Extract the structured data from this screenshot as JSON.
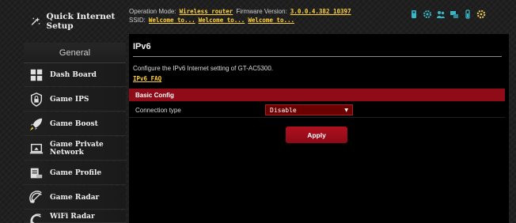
{
  "sidebar": {
    "quick_setup_label": "Quick Internet Setup",
    "quick_setup_icon": "wizard-icon",
    "section_header": "General",
    "items": [
      {
        "label": "Dash Board",
        "icon": "dashboard-icon"
      },
      {
        "label": "Game IPS",
        "icon": "shield-lock-icon"
      },
      {
        "label": "Game Boost",
        "icon": "rocket-icon"
      },
      {
        "label": "Game Private Network",
        "icon": "laptop-icon"
      },
      {
        "label": "Game Profile",
        "icon": "profile-icon"
      },
      {
        "label": "Game Radar",
        "icon": "radar-icon"
      },
      {
        "label": "WiFi Radar",
        "icon": "wifi-radar-icon"
      }
    ]
  },
  "topbar": {
    "operation_mode_label": "Operation Mode:",
    "operation_mode_value": "Wireless router",
    "firmware_label": "Firmware Version:",
    "firmware_value": "3.0.0.4.382_10397",
    "ssid_label": "SSID:",
    "ssid_values": [
      "Welcome to...",
      "Welcome to...",
      "Welcome to..."
    ],
    "status_icons": [
      "usb-icon",
      "gear-icon",
      "users-icon",
      "network-icon",
      "battery-icon",
      "settings-icon"
    ]
  },
  "main": {
    "title": "IPv6",
    "description": "Configure the IPv6 Internet setting of GT-AC5300.",
    "faq_link": "IPv6 FAQ",
    "section_title": "Basic Config",
    "connection_type_label": "Connection type",
    "connection_type_value": "Disable",
    "apply_label": "Apply"
  },
  "colors": {
    "accent_red": "#8e0b17",
    "link_yellow": "#ffd23a",
    "panel_black": "#000000"
  }
}
